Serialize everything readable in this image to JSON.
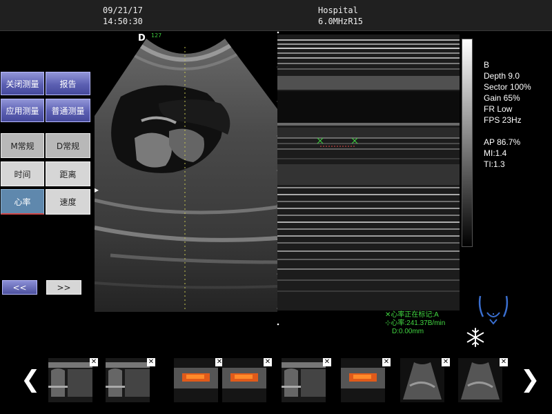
{
  "header": {
    "date": "09/21/17",
    "time": "14:50:30",
    "hospital": "Hospital",
    "probe": "6.0MHzR15"
  },
  "panel": {
    "close_measure": "关闭测量",
    "report": "报告",
    "app_measure": "应用测量",
    "general_measure": "普通测量",
    "m_regular": "M常规",
    "d_regular": "D常规",
    "time": "时间",
    "distance": "距离",
    "heart_rate": "心率",
    "velocity": "速度",
    "prev_page": "<<",
    "next_page": ">>"
  },
  "image": {
    "direction_mark": "D",
    "depth_mark": "127",
    "side_arrow": "▸"
  },
  "params": {
    "mode": "B",
    "depth": "Depth 9.0",
    "sector": "Sector 100%",
    "gain": "Gain 65%",
    "frame_rate": "FR Low",
    "fps": "FPS 23Hz",
    "ap": "AP 86.7%",
    "mi": "MI:1.4",
    "ti": "TI:1.3"
  },
  "measurement": {
    "status": "✕心率正在标记:A",
    "heart_rate": "⊹心率:241.37B/min",
    "distance": "D:0.00mm"
  },
  "thumbnails": {
    "close_symbol": "✕",
    "items": [
      "mmode",
      "mmode",
      "color",
      "color",
      "mmode",
      "color",
      "sector",
      "sector"
    ],
    "prev": "❮",
    "next": "❯"
  },
  "colors": {
    "accent_green": "#42d742",
    "button_blue": "#5b5fb2",
    "button_active": "#5f88ad"
  }
}
